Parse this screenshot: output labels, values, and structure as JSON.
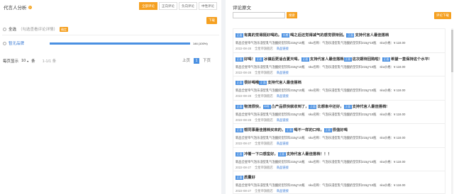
{
  "left": {
    "title": "代言人分析",
    "help_icon": "question-circle-icon",
    "tabs": [
      "全部评论",
      "正向评论",
      "负向评论",
      "中性评论"
    ],
    "download_label": "下载",
    "select_all_label": "全选",
    "hint": "（勾选查看评论详情）",
    "confirm_label": "确定",
    "bar": {
      "label": "暂无品牌",
      "value_text": "146 (100%)",
      "fraction": 1.0
    },
    "pager": {
      "per_page_label": "每页显示",
      "per_page_value": "10",
      "unit": "条",
      "range": "1-1/1 条",
      "prev": "上页",
      "current": "1",
      "next": "下页"
    }
  },
  "right": {
    "title": "评论原文",
    "search_placeholder": "",
    "search_label": "搜索",
    "export_label": "评论下载",
    "items": [
      {
        "segments": [
          {
            "tag": "正面"
          },
          {
            "text": "有真的觉得挺好喝的。"
          },
          {
            "tag": "口感"
          },
          {
            "text": "喝之后还觉得减气的感觉很特别。"
          },
          {
            "tag": "正面"
          },
          {
            "text": "支持代言人最佳搭档"
          }
        ],
        "product": "新品全星帝气泡乐浸型乳气泡酸奶型饮料215g*10瓶",
        "spec": "sku名称：气泡乐浸型乳气泡酸奶型饮料215g*10瓶",
        "price": "sku价格：¥ 118.00",
        "date": "2022-08-28",
        "shop": "全星帝旗舰店",
        "link": "商品链接"
      },
      {
        "segments": [
          {
            "tag": "正面"
          },
          {
            "text": "好喝！"
          },
          {
            "tag": "正面"
          },
          {
            "text": "冰镇后更适合夏天喝，"
          },
          {
            "tag": "正面"
          },
          {
            "text": "支持代言人最佳搭档"
          },
          {
            "tag": "正面"
          },
          {
            "text": "这次期待回购啦！"
          },
          {
            "tag": "正面"
          },
          {
            "text": "希望一直保持这个水平!"
          }
        ],
        "product": "新品全星帝气泡乐浸型乳气泡酸奶型饮料215g*10瓶",
        "spec": "sku名称：气泡乐浸型乳气泡酸奶型饮料215g*10瓶",
        "price": "sku价格：¥ 118.00",
        "date": "2022-08-28",
        "shop": "全星帝旗舰店",
        "link": "商品链接"
      },
      {
        "segments": [
          {
            "tag": "正面"
          },
          {
            "text": "很好喝哦"
          },
          {
            "tag": "正面"
          },
          {
            "text": "支持代言人最佳搭档"
          }
        ],
        "product": "新品全星帝气泡乐浸型乳气泡酸奶型饮料215g*10瓶",
        "spec": "sku名称：气泡乐浸型乳气泡酸奶型饮料215g*10瓶",
        "price": "sku价格：¥ 118.00",
        "date": "2022-08-28",
        "shop": "全星帝旗舰店",
        "link": "商品链接"
      },
      {
        "segments": [
          {
            "tag": "正面"
          },
          {
            "text": "物流很快，"
          },
          {
            "tag": "中性"
          },
          {
            "text": "⚠产品很快就收到了，"
          },
          {
            "tag": "正面"
          },
          {
            "text": "比想象中还好，"
          },
          {
            "tag": "正面"
          },
          {
            "text": "支持代言人最佳搭档!"
          }
        ],
        "product": "新品全星帝气泡乐浸型乳气泡酸奶型饮料215g*10瓶",
        "spec": "sku名称：气泡乐浸型乳气泡酸奶型饮料215g*10瓶",
        "price": "sku价格：¥ 118.00",
        "date": "2022-08-28",
        "shop": "全星帝旗舰店",
        "link": "商品链接"
      },
      {
        "segments": [
          {
            "tag": "正面"
          },
          {
            "text": "帮同事最佳搭档买来的，"
          },
          {
            "tag": "正面"
          },
          {
            "text": "喝不一样的口味，"
          },
          {
            "tag": "正面"
          },
          {
            "text": "很值好喝"
          }
        ],
        "product": "新品全星帝气泡乐浸型乳气泡酸奶型饮料215g*10瓶",
        "spec": "sku名称：气泡乐浸型乳气泡酸奶型饮料215g*10瓶",
        "price": "sku价格：¥ 118.00",
        "date": "2022-08-27",
        "shop": "全星帝旗舰店",
        "link": "商品链接"
      },
      {
        "segments": [
          {
            "tag": "正面"
          },
          {
            "text": "冲着一下口感蛮好，"
          },
          {
            "tag": "正面"
          },
          {
            "text": "支持代言人最佳搭档！！！"
          }
        ],
        "product": "新品全星帝气泡乐浸型乳气泡酸奶型饮料215g*10瓶",
        "spec": "sku名称：气泡乐浸型乳气泡酸奶型饮料215g*10瓶",
        "price": "sku价格：¥ 118.00",
        "date": "2022-08-27",
        "shop": "全星帝旗舰店",
        "link": "商品链接"
      },
      {
        "segments": [
          {
            "tag": "正面"
          },
          {
            "text": "质量好"
          }
        ],
        "product": "新品全星帝气泡乐浸型乳气泡酸奶型饮料215g*10瓶",
        "spec": "sku名称：气泡乐浸型乳气泡酸奶型饮料215g*10瓶",
        "price": "sku价格：¥ 118.00",
        "date": "2022-08-27",
        "shop": "全星帝旗舰店",
        "link": "商品链接"
      }
    ]
  },
  "colors": {
    "accent": "#f5a020",
    "brand_blue": "#4a90e2"
  }
}
